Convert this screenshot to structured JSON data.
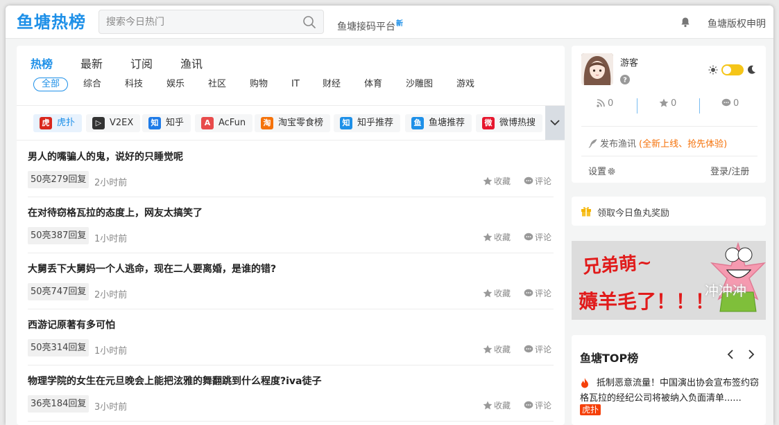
{
  "header": {
    "logo": "鱼塘热榜",
    "search_placeholder": "搜索今日热门",
    "platform": "鱼塘接码平台",
    "platform_badge": "新",
    "copyright": "鱼塘版权申明"
  },
  "tabs": [
    "热榜",
    "最新",
    "订阅",
    "渔讯"
  ],
  "categories": [
    "全部",
    "综合",
    "科技",
    "娱乐",
    "社区",
    "购物",
    "IT",
    "财经",
    "体育",
    "沙雕图",
    "游戏"
  ],
  "sources": [
    {
      "label": "虎扑",
      "icon": "hupu-icon",
      "glyph": "虎",
      "color": "#d9261c"
    },
    {
      "label": "V2EX",
      "icon": "v2ex-icon",
      "glyph": "▷",
      "color": "#333333"
    },
    {
      "label": "知乎",
      "icon": "zhihu-icon",
      "glyph": "知",
      "color": "#1e7be8"
    },
    {
      "label": "AcFun",
      "icon": "acfun-icon",
      "glyph": "A",
      "color": "#e84b4b"
    },
    {
      "label": "淘宝零食榜",
      "icon": "taobao-icon",
      "glyph": "淘",
      "color": "#f5720a"
    },
    {
      "label": "知乎推荐",
      "icon": "zhihu-rec-icon",
      "glyph": "知",
      "color": "#1e90e8"
    },
    {
      "label": "鱼塘推荐",
      "icon": "yutang-icon",
      "glyph": "鱼",
      "color": "#1e90e8"
    },
    {
      "label": "微博热搜",
      "icon": "weibo-icon",
      "glyph": "微",
      "color": "#e6162d"
    }
  ],
  "list": [
    {
      "title": "男人的嘴骗人的鬼，说好的只睡觉呢",
      "count": "50亮279回复",
      "time": "2小时前"
    },
    {
      "title": "在对待窃格瓦拉的态度上，网友太搞笑了",
      "count": "50亮387回复",
      "time": "1小时前"
    },
    {
      "title": "大舅丢下大舅妈一个人逃命，现在二人要离婚，是谁的错?",
      "count": "50亮747回复",
      "time": "2小时前"
    },
    {
      "title": "西游记原著有多可怕",
      "count": "50亮314回复",
      "time": "1小时前"
    },
    {
      "title": "物理学院的女生在元旦晚会上能把泫雅的舞翻跳到什么程度?iva徒子",
      "count": "36亮184回复",
      "time": "3小时前"
    }
  ],
  "actions": {
    "favorite": "收藏",
    "comment": "评论"
  },
  "user": {
    "name": "游客",
    "rss_count": "0",
    "star_count": "0",
    "comment_count": "0",
    "publish": "发布渔讯",
    "publish_hot": "(全新上线、抢先体验)",
    "settings": "设置",
    "login": "登录/注册"
  },
  "reward": "领取今日鱼丸奖励",
  "banner": {
    "line1": "兄弟萌~",
    "line2": "薅羊毛了！！！",
    "line3": "冲冲冲"
  },
  "top": {
    "title": "鱼塘TOP榜",
    "item": "抵制恶意流量！中国演出协会宣布签约窃格瓦拉的经纪公司将被纳入负面清单......",
    "badge": "虎扑"
  },
  "colors": {
    "accent": "#1e90e8",
    "hot": "#f5720a",
    "toggle": "#f5c518"
  }
}
